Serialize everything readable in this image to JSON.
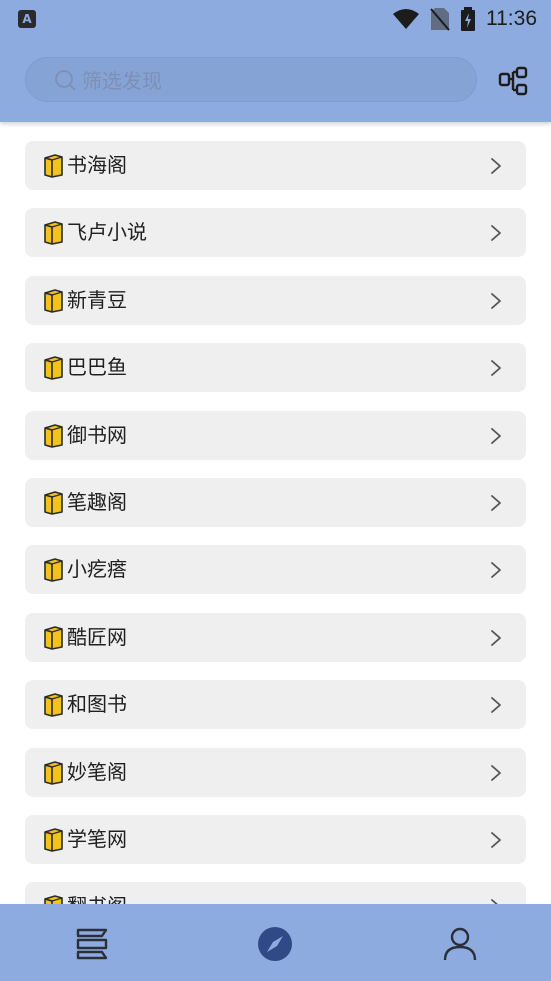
{
  "status": {
    "time": "11:36",
    "app_badge": "A"
  },
  "search": {
    "placeholder": "筛选发现"
  },
  "icons": {
    "search": "search-icon",
    "layout": "layout-toggle-icon",
    "book": "book-icon",
    "chevron": "chevron-right-icon",
    "bookshelf": "bookshelf-icon",
    "compass": "compass-icon",
    "user": "user-icon"
  },
  "colors": {
    "bar": "#8eabdf",
    "item_bg": "#efefef",
    "active_nav": "#2f4a86"
  },
  "items": [
    {
      "label": "书海阁"
    },
    {
      "label": "飞卢小说"
    },
    {
      "label": "新青豆"
    },
    {
      "label": "巴巴鱼"
    },
    {
      "label": "御书网"
    },
    {
      "label": "笔趣阁"
    },
    {
      "label": "小疙瘩"
    },
    {
      "label": "酷匠网"
    },
    {
      "label": "和图书"
    },
    {
      "label": "妙笔阁"
    },
    {
      "label": "学笔网"
    },
    {
      "label": "翻书阁"
    }
  ]
}
